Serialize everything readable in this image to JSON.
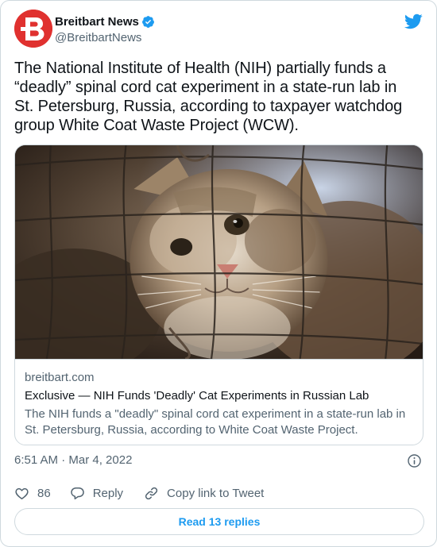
{
  "author": {
    "display_name": "Breitbart News",
    "handle": "@BreitbartNews",
    "avatar_letter": "B",
    "avatar_color": "#e0312f",
    "verified": true
  },
  "icons": {
    "platform": "twitter-bird-icon",
    "verified": "verified-badge-icon",
    "info": "info-icon",
    "like": "heart-icon",
    "reply": "reply-bubble-icon",
    "copy": "link-icon"
  },
  "tweet": {
    "text": "The National Institute of Health (NIH) partially funds a “deadly” spinal cord cat experiment in a state-run lab in St. Petersburg, Russia, according to taxpayer watchdog group White Coat Waste Project (WCW)."
  },
  "card": {
    "domain": "breitbart.com",
    "title": "Exclusive — NIH Funds 'Deadly' Cat Experiments in Russian Lab",
    "description": "The NIH funds a \"deadly\" spinal cord cat experiment in a state-run lab in St. Petersburg, Russia, according to White Coat Waste Project."
  },
  "meta": {
    "timestamp": "6:51 AM · Mar 4, 2022"
  },
  "actions": {
    "like_count": "86",
    "reply_label": "Reply",
    "copy_label": "Copy link to Tweet"
  },
  "footer": {
    "read_replies_label": "Read 13 replies"
  },
  "colors": {
    "accent": "#1d9bf0",
    "secondary_text": "#536471",
    "border": "#cfd9de"
  }
}
